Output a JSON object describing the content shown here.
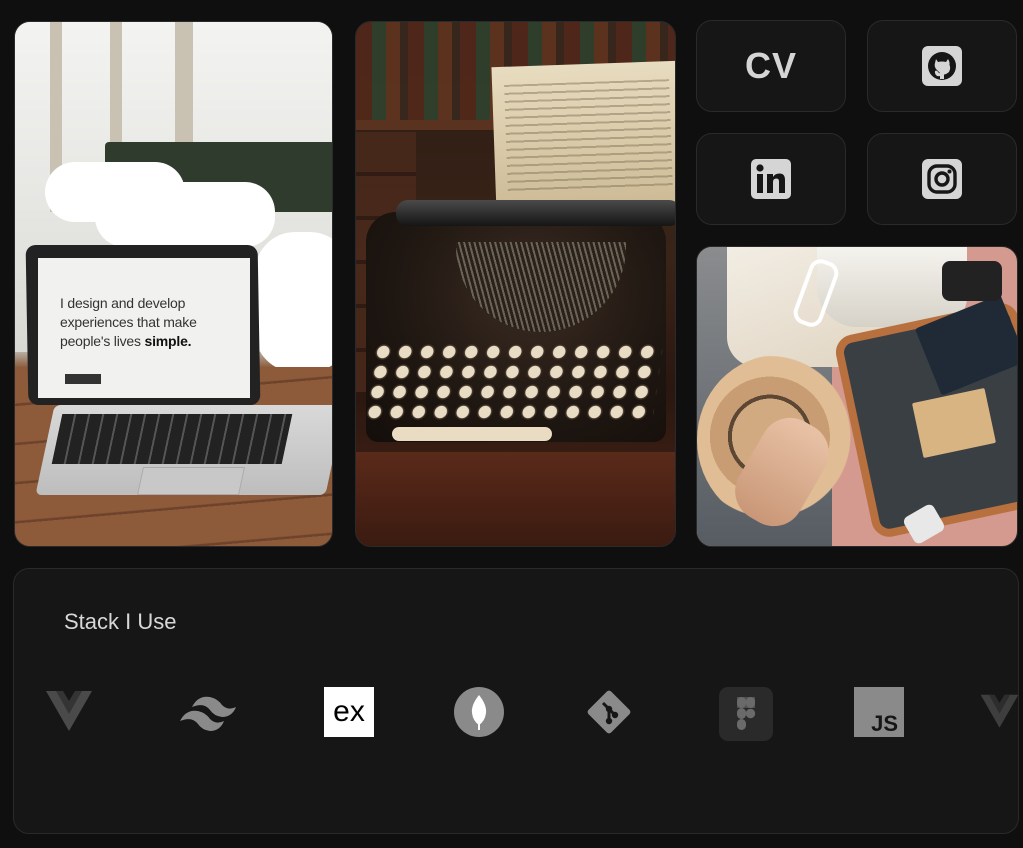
{
  "photos": {
    "laptop_screen_text_line1": "I design and develop",
    "laptop_screen_text_line2": "experiences that make",
    "laptop_screen_text_line3_pre": "people's lives ",
    "laptop_screen_text_line3_bold": "simple."
  },
  "links": {
    "cv_label": "CV",
    "github_icon": "github-icon",
    "linkedin_icon": "linkedin-icon",
    "instagram_icon": "instagram-icon"
  },
  "stack": {
    "title": "Stack I Use",
    "icons": [
      "vue-icon",
      "tailwind-icon",
      "express-icon",
      "mongodb-icon",
      "git-icon",
      "figma-icon",
      "javascript-icon",
      "vue-icon"
    ]
  },
  "colors": {
    "background": "#0f0f0f",
    "card": "#161616",
    "card_border": "#2a2a2a",
    "text": "#d8d8d8"
  }
}
